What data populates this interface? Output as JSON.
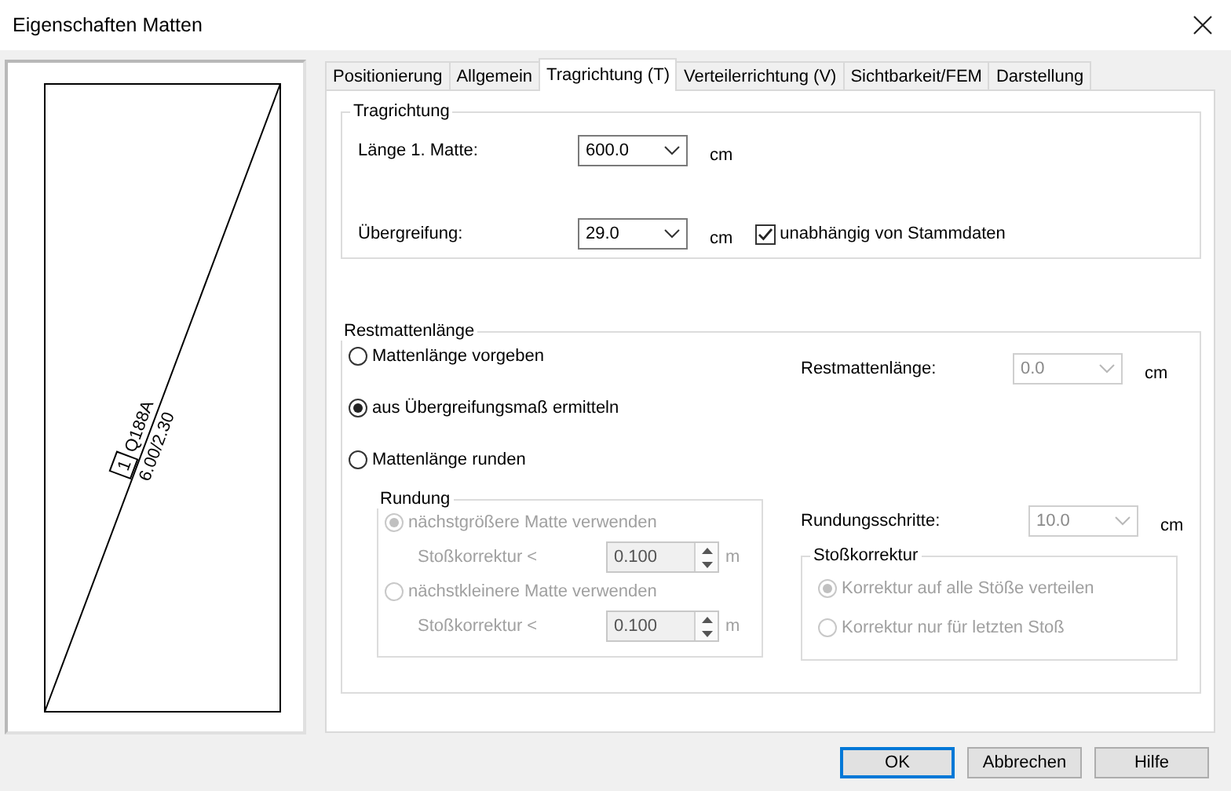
{
  "window": {
    "title": "Eigenschaften Matten"
  },
  "preview": {
    "mark_number": "1",
    "mat_type": "Q188A",
    "dimensions": "6.00/2.30"
  },
  "tabs": [
    {
      "label": "Positionierung",
      "selected": false
    },
    {
      "label": "Allgemein",
      "selected": false
    },
    {
      "label": "Tragrichtung (T)",
      "selected": true
    },
    {
      "label": "Verteilerrichtung (V)",
      "selected": false
    },
    {
      "label": "Sichtbarkeit/FEM",
      "selected": false
    },
    {
      "label": "Darstellung",
      "selected": false
    }
  ],
  "tragrichtung": {
    "title": "Tragrichtung",
    "fields": [
      {
        "label": "Länge 1. Matte:",
        "value": "600.0",
        "unit": "cm"
      },
      {
        "label": "Übergreifung:",
        "value": "29.0",
        "unit": "cm"
      }
    ],
    "checkbox": {
      "label": "unabhängig von Stammdaten",
      "checked": true
    }
  },
  "restmattenlaenge": {
    "title": "Restmattenlänge",
    "options": [
      {
        "label": "Mattenlänge vorgeben",
        "selected": false
      },
      {
        "label": "aus Übergreifungsmaß ermitteln",
        "selected": true
      },
      {
        "label": "Mattenlänge runden",
        "selected": false
      }
    ],
    "rest_field": {
      "label": "Restmattenlänge:",
      "value": "0.0",
      "unit": "cm",
      "disabled": true
    },
    "rundung": {
      "title": "Rundung",
      "options": [
        {
          "label": "nächstgrößere Matte verwenden",
          "selected": true,
          "disabled": true,
          "spin_label": "Stoßkorrektur <",
          "value": "0.100",
          "unit": "m"
        },
        {
          "label": "nächstkleinere Matte verwenden",
          "selected": false,
          "disabled": true,
          "spin_label": "Stoßkorrektur <",
          "value": "0.100",
          "unit": "m"
        }
      ]
    },
    "step_field": {
      "label": "Rundungsschritte:",
      "value": "10.0",
      "unit": "cm",
      "disabled": true
    },
    "stosskorrektur": {
      "title": "Stoßkorrektur",
      "options": [
        {
          "label": "Korrektur auf alle Stöße verteilen",
          "selected": true,
          "disabled": true
        },
        {
          "label": "Korrektur nur für letzten Stoß",
          "selected": false,
          "disabled": true
        }
      ]
    }
  },
  "buttons": [
    {
      "label": "OK",
      "default": true
    },
    {
      "label": "Abbrechen",
      "default": false
    },
    {
      "label": "Hilfe",
      "default": false
    }
  ]
}
